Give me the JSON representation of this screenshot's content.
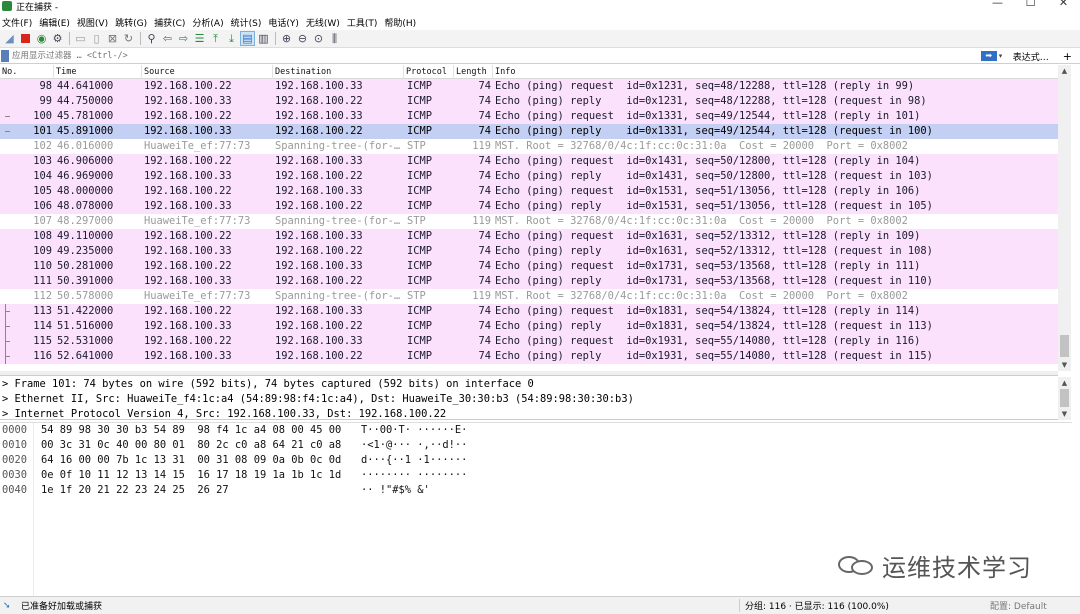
{
  "window": {
    "title": "正在捕获 -",
    "minimize": "—",
    "maximize": "☐",
    "close": "✕"
  },
  "menu": [
    "文件(F)",
    "编辑(E)",
    "视图(V)",
    "跳转(G)",
    "捕获(C)",
    "分析(A)",
    "统计(S)",
    "电话(Y)",
    "无线(W)",
    "工具(T)",
    "帮助(H)"
  ],
  "filter": {
    "placeholder": "应用显示过滤器 … <Ctrl-/>",
    "expression_label": "表达式…",
    "apply": "➡",
    "dropdown": "▾",
    "add": "+"
  },
  "columns": [
    "No.",
    "Time",
    "Source",
    "Destination",
    "Protocol",
    "Length",
    "Info"
  ],
  "packets": [
    {
      "no": "98",
      "time": "44.641000",
      "src": "192.168.100.22",
      "dst": "192.168.100.33",
      "proto": "ICMP",
      "len": "74",
      "info": "Echo (ping) request  id=0x1231, seq=48/12288, ttl=128 (reply in 99)"
    },
    {
      "no": "99",
      "time": "44.750000",
      "src": "192.168.100.33",
      "dst": "192.168.100.22",
      "proto": "ICMP",
      "len": "74",
      "info": "Echo (ping) reply    id=0x1231, seq=48/12288, ttl=128 (request in 98)"
    },
    {
      "no": "100",
      "time": "45.781000",
      "src": "192.168.100.22",
      "dst": "192.168.100.33",
      "proto": "ICMP",
      "len": "74",
      "info": "Echo (ping) request  id=0x1331, seq=49/12544, ttl=128 (reply in 101)"
    },
    {
      "no": "101",
      "time": "45.891000",
      "src": "192.168.100.33",
      "dst": "192.168.100.22",
      "proto": "ICMP",
      "len": "74",
      "info": "Echo (ping) reply    id=0x1331, seq=49/12544, ttl=128 (request in 100)"
    },
    {
      "no": "102",
      "time": "46.016000",
      "src": "HuaweiTe_ef:77:73",
      "dst": "Spanning-tree-(for-…",
      "proto": "STP",
      "len": "119",
      "info": "MST. Root = 32768/0/4c:1f:cc:0c:31:0a  Cost = 20000  Port = 0x8002"
    },
    {
      "no": "103",
      "time": "46.906000",
      "src": "192.168.100.22",
      "dst": "192.168.100.33",
      "proto": "ICMP",
      "len": "74",
      "info": "Echo (ping) request  id=0x1431, seq=50/12800, ttl=128 (reply in 104)"
    },
    {
      "no": "104",
      "time": "46.969000",
      "src": "192.168.100.33",
      "dst": "192.168.100.22",
      "proto": "ICMP",
      "len": "74",
      "info": "Echo (ping) reply    id=0x1431, seq=50/12800, ttl=128 (request in 103)"
    },
    {
      "no": "105",
      "time": "48.000000",
      "src": "192.168.100.22",
      "dst": "192.168.100.33",
      "proto": "ICMP",
      "len": "74",
      "info": "Echo (ping) request  id=0x1531, seq=51/13056, ttl=128 (reply in 106)"
    },
    {
      "no": "106",
      "time": "48.078000",
      "src": "192.168.100.33",
      "dst": "192.168.100.22",
      "proto": "ICMP",
      "len": "74",
      "info": "Echo (ping) reply    id=0x1531, seq=51/13056, ttl=128 (request in 105)"
    },
    {
      "no": "107",
      "time": "48.297000",
      "src": "HuaweiTe_ef:77:73",
      "dst": "Spanning-tree-(for-…",
      "proto": "STP",
      "len": "119",
      "info": "MST. Root = 32768/0/4c:1f:cc:0c:31:0a  Cost = 20000  Port = 0x8002"
    },
    {
      "no": "108",
      "time": "49.110000",
      "src": "192.168.100.22",
      "dst": "192.168.100.33",
      "proto": "ICMP",
      "len": "74",
      "info": "Echo (ping) request  id=0x1631, seq=52/13312, ttl=128 (reply in 109)"
    },
    {
      "no": "109",
      "time": "49.235000",
      "src": "192.168.100.33",
      "dst": "192.168.100.22",
      "proto": "ICMP",
      "len": "74",
      "info": "Echo (ping) reply    id=0x1631, seq=52/13312, ttl=128 (request in 108)"
    },
    {
      "no": "110",
      "time": "50.281000",
      "src": "192.168.100.22",
      "dst": "192.168.100.33",
      "proto": "ICMP",
      "len": "74",
      "info": "Echo (ping) request  id=0x1731, seq=53/13568, ttl=128 (reply in 111)"
    },
    {
      "no": "111",
      "time": "50.391000",
      "src": "192.168.100.33",
      "dst": "192.168.100.22",
      "proto": "ICMP",
      "len": "74",
      "info": "Echo (ping) reply    id=0x1731, seq=53/13568, ttl=128 (request in 110)"
    },
    {
      "no": "112",
      "time": "50.578000",
      "src": "HuaweiTe_ef:77:73",
      "dst": "Spanning-tree-(for-…",
      "proto": "STP",
      "len": "119",
      "info": "MST. Root = 32768/0/4c:1f:cc:0c:31:0a  Cost = 20000  Port = 0x8002"
    },
    {
      "no": "113",
      "time": "51.422000",
      "src": "192.168.100.22",
      "dst": "192.168.100.33",
      "proto": "ICMP",
      "len": "74",
      "info": "Echo (ping) request  id=0x1831, seq=54/13824, ttl=128 (reply in 114)"
    },
    {
      "no": "114",
      "time": "51.516000",
      "src": "192.168.100.33",
      "dst": "192.168.100.22",
      "proto": "ICMP",
      "len": "74",
      "info": "Echo (ping) reply    id=0x1831, seq=54/13824, ttl=128 (request in 113)"
    },
    {
      "no": "115",
      "time": "52.531000",
      "src": "192.168.100.22",
      "dst": "192.168.100.33",
      "proto": "ICMP",
      "len": "74",
      "info": "Echo (ping) request  id=0x1931, seq=55/14080, ttl=128 (reply in 116)"
    },
    {
      "no": "116",
      "time": "52.641000",
      "src": "192.168.100.33",
      "dst": "192.168.100.22",
      "proto": "ICMP",
      "len": "74",
      "info": "Echo (ping) reply    id=0x1931, seq=55/14080, ttl=128 (request in 115)"
    }
  ],
  "selected_packet": "101",
  "details": [
    "> Frame 101: 74 bytes on wire (592 bits), 74 bytes captured (592 bits) on interface 0",
    "> Ethernet II, Src: HuaweiTe_f4:1c:a4 (54:89:98:f4:1c:a4), Dst: HuaweiTe_30:30:b3 (54:89:98:30:30:b3)",
    "> Internet Protocol Version 4, Src: 192.168.100.33, Dst: 192.168.100.22"
  ],
  "bytes": [
    {
      "offset": "0000",
      "hex": "54 89 98 30 30 b3 54 89  98 f4 1c a4 08 00 45 00",
      "ascii": "T··00·T· ······E·"
    },
    {
      "offset": "0010",
      "hex": "00 3c 31 0c 40 00 80 01  80 2c c0 a8 64 21 c0 a8",
      "ascii": "·<1·@··· ·,··d!··"
    },
    {
      "offset": "0020",
      "hex": "64 16 00 00 7b 1c 13 31  00 31 08 09 0a 0b 0c 0d",
      "ascii": "d···{··1 ·1······"
    },
    {
      "offset": "0030",
      "hex": "0e 0f 10 11 12 13 14 15  16 17 18 19 1a 1b 1c 1d",
      "ascii": "········ ········"
    },
    {
      "offset": "0040",
      "hex": "1e 1f 20 21 22 23 24 25  26 27",
      "ascii": "·· !\"#$% &'"
    }
  ],
  "watermark": "运维技术学习",
  "status": {
    "ready": "已准备好加载或捕获",
    "packets": "分组: 116 · 已显示: 116 (100.0%)",
    "profile": "配置: Default"
  },
  "colors": {
    "icmp_row": "#fbe1fb",
    "stp_row": "#ffffff",
    "selected_row": "#c4cff4"
  }
}
